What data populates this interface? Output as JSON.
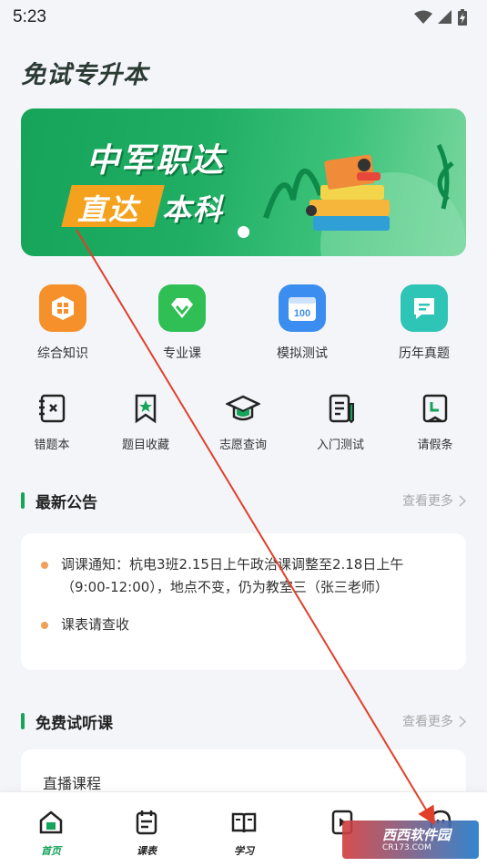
{
  "status_bar": {
    "time": "5:23"
  },
  "app": {
    "title": "免试专升本"
  },
  "banner": {
    "line1": "中军职达",
    "highlight": "直达",
    "line2": "本科",
    "accent_color": "#f4a21d",
    "brand_color": "#16a35a"
  },
  "quick_grid": [
    {
      "label": "综合知识",
      "icon": "grid-box-icon",
      "color": "#f5902a"
    },
    {
      "label": "专业课",
      "icon": "diamond-icon",
      "color": "#2fbf55"
    },
    {
      "label": "模拟测试",
      "icon": "calendar-100-icon",
      "color": "#3b8ef0",
      "badge": "100"
    },
    {
      "label": "历年真题",
      "icon": "chat-doc-icon",
      "color": "#2ec4b6"
    }
  ],
  "secondary_grid": [
    {
      "label": "错题本",
      "icon": "wrong-book-icon"
    },
    {
      "label": "题目收藏",
      "icon": "bookmark-star-icon"
    },
    {
      "label": "志愿查询",
      "icon": "graduation-cap-icon"
    },
    {
      "label": "入门测试",
      "icon": "test-paper-icon"
    },
    {
      "label": "请假条",
      "icon": "leave-note-icon"
    }
  ],
  "announcements": {
    "title": "最新公告",
    "more": "查看更多",
    "items": [
      {
        "text": "调课通知：杭电3班2.15日上午政治课调整至2.18日上午（9:00-12:00），地点不变，仍为教室三（张三老师）"
      },
      {
        "text": "课表请查收"
      }
    ]
  },
  "free_courses": {
    "title": "免费试听课",
    "more": "查看更多",
    "first_item": "直播课程"
  },
  "tabbar": {
    "tabs": [
      {
        "label": "首页",
        "icon": "home-icon",
        "active": true
      },
      {
        "label": "课表",
        "icon": "schedule-icon",
        "active": false
      },
      {
        "label": "学习",
        "icon": "book-open-icon",
        "active": false
      },
      {
        "label": "",
        "icon": "play-doc-icon",
        "active": false
      },
      {
        "label": "",
        "icon": "profile-ghost-icon",
        "active": false
      }
    ]
  },
  "watermark": {
    "main": "西西软件园",
    "sub": "CR173.COM"
  }
}
